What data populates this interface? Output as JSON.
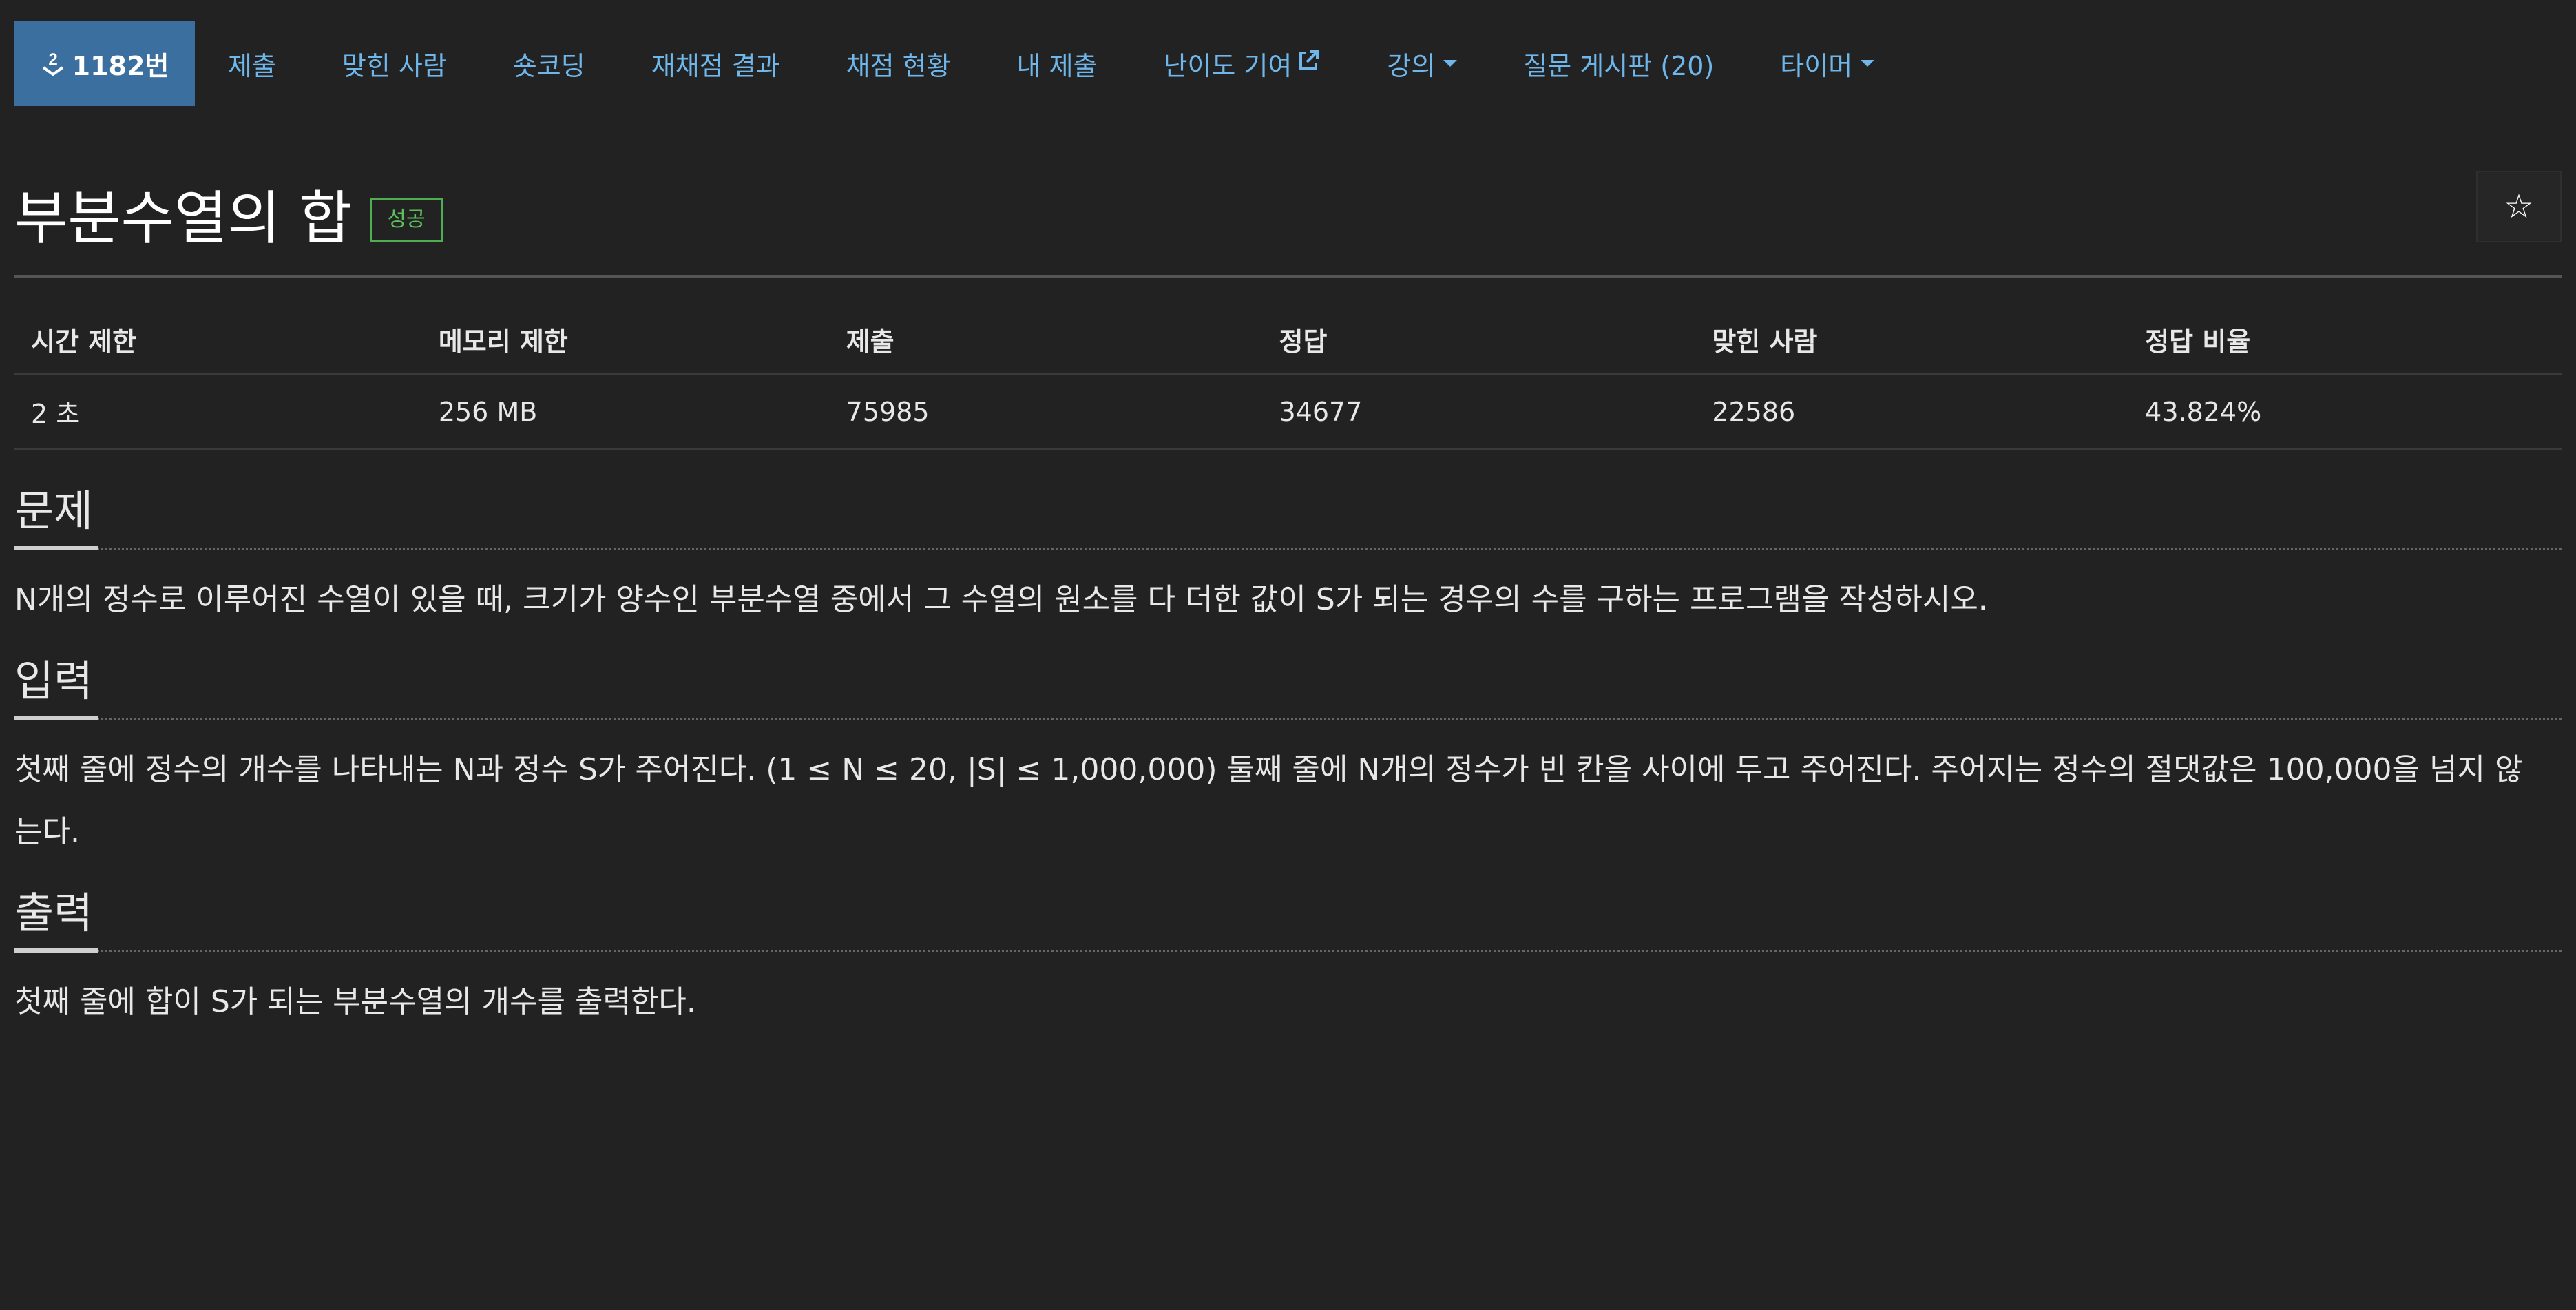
{
  "nav": {
    "brand": "1182번",
    "items": [
      {
        "label": "제출",
        "dropdown": false
      },
      {
        "label": "맞힌 사람",
        "dropdown": false
      },
      {
        "label": "숏코딩",
        "dropdown": false
      },
      {
        "label": "재채점 결과",
        "dropdown": false
      },
      {
        "label": "채점 현황",
        "dropdown": false
      },
      {
        "label": "내 제출",
        "dropdown": false
      },
      {
        "label": "난이도 기여",
        "dropdown": false,
        "external": true
      },
      {
        "label": "강의",
        "dropdown": true
      },
      {
        "label": "질문 게시판 (20)",
        "dropdown": false
      },
      {
        "label": "타이머",
        "dropdown": true
      }
    ]
  },
  "problem": {
    "title": "부분수열의 합",
    "badge": "성공",
    "star": "☆"
  },
  "info": {
    "headers": [
      "시간 제한",
      "메모리 제한",
      "제출",
      "정답",
      "맞힌 사람",
      "정답 비율"
    ],
    "values": [
      "2 초",
      "256 MB",
      "75985",
      "34677",
      "22586",
      "43.824%"
    ]
  },
  "sections": {
    "problem": {
      "title": "문제",
      "text": "N개의 정수로 이루어진 수열이 있을 때, 크기가 양수인 부분수열 중에서 그 수열의 원소를 다 더한 값이 S가 되는 경우의 수를 구하는 프로그램을 작성하시오."
    },
    "input": {
      "title": "입력",
      "text": "첫째 줄에 정수의 개수를 나타내는 N과 정수 S가 주어진다. (1 ≤ N ≤ 20, |S| ≤ 1,000,000) 둘째 줄에 N개의 정수가 빈 칸을 사이에 두고 주어진다. 주어지는 정수의 절댓값은 100,000을 넘지 않는다."
    },
    "output": {
      "title": "출력",
      "text": "첫째 줄에 합이 S가 되는 부분수열의 개수를 출력한다."
    }
  },
  "colors": {
    "background": "#222222",
    "brand_bg": "#3b6fa0",
    "link": "#6fb6ea",
    "success": "#5cbf5c"
  }
}
